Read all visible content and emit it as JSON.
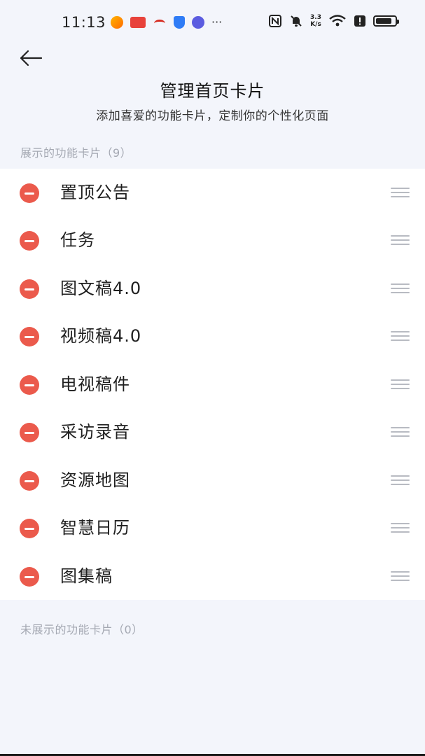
{
  "status_bar": {
    "time": "11:13",
    "more": "···",
    "net_speed_value": "3.3",
    "net_speed_unit": "K/s",
    "battery_level_percent": 85
  },
  "header": {
    "title": "管理首页卡片",
    "subtitle": "添加喜爱的功能卡片，定制你的个性化页面"
  },
  "shown_section": {
    "label": "展示的功能卡片（9）",
    "items": [
      {
        "label": "置顶公告"
      },
      {
        "label": "任务"
      },
      {
        "label": "图文稿4.0"
      },
      {
        "label": "视频稿4.0"
      },
      {
        "label": "电视稿件"
      },
      {
        "label": "采访录音"
      },
      {
        "label": "资源地图"
      },
      {
        "label": "智慧日历"
      },
      {
        "label": "图集稿"
      }
    ]
  },
  "hidden_section": {
    "label": "未展示的功能卡片（0）"
  },
  "colors": {
    "background": "#f3f5fb",
    "remove_red": "#eb5a4c",
    "section_label_gray": "#a4a8b2",
    "card_bg": "#ffffff"
  }
}
